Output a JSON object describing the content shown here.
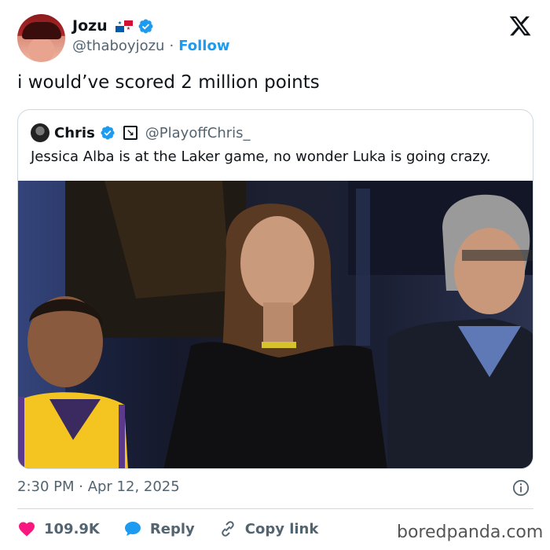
{
  "tweet": {
    "author": {
      "name": "Jozu",
      "handle": "@thaboyjozu",
      "separator": "·",
      "follow_label": "Follow"
    },
    "text": "i would’ve scored 2 million points",
    "timestamp": "2:30 PM · Apr 12, 2025",
    "actions": {
      "like_count": "109.9K",
      "reply_label": "Reply",
      "copy_link_label": "Copy link"
    }
  },
  "quoted_tweet": {
    "name": "Chris",
    "handle": "@PlayoffChris_",
    "text": "Jessica Alba is at the Laker game, no wonder Luka is going crazy.",
    "image_description_icon": "photo-courtside-crowd"
  },
  "watermark": "boredpanda.com",
  "colors": {
    "accent": "#1d9bf0",
    "like": "#f91880",
    "text_primary": "#0f1419",
    "text_secondary": "#536471",
    "border": "#cfd9de"
  },
  "icons": {
    "verified": "verified-badge-icon",
    "x_logo": "x-logo-icon",
    "info": "info-icon",
    "heart": "heart-icon",
    "reply": "reply-bubble-icon",
    "link": "link-icon",
    "flag": "panama-flag-icon",
    "affiliate": "affiliate-badge-icon"
  }
}
